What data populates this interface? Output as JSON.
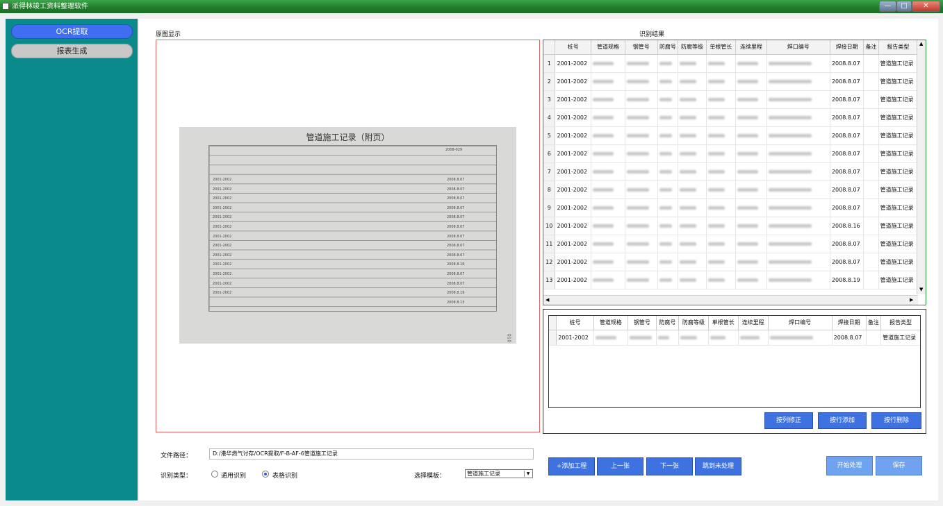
{
  "window": {
    "title": "派得林竣工资料整理软件",
    "min": "—",
    "max": "□",
    "close": "✕"
  },
  "sidebar": {
    "items": [
      {
        "label": "OCR提取"
      },
      {
        "label": "报表生成"
      }
    ]
  },
  "original": {
    "label": "原图显示",
    "doc_title": "管道施工记录（附页）",
    "doc_header": "2008-029",
    "doc_rows": [
      "2001-2002",
      "2001-2002",
      "2001-2002",
      "2001-2002",
      "2001-2002",
      "2001-2002",
      "2001-2002",
      "2001-2002",
      "2001-2002",
      "2001-2002",
      "2001-2002",
      "2001-2002",
      "2001-2002"
    ],
    "doc_dates": [
      "2008.8.07",
      "2008.8.07",
      "2008.8.07",
      "2008.8.07",
      "2008.8.07",
      "2008.8.07",
      "2008.8.07",
      "2008.8.07",
      "2008.8.07",
      "2008.8.16",
      "2008.8.07",
      "2008.8.07",
      "2008.8.19",
      "2008.8.13"
    ],
    "doc_number": "010"
  },
  "result": {
    "label": "识别结果",
    "columns": [
      "桩号",
      "管道规格",
      "钢管号",
      "防腐号",
      "防腐等级",
      "单根管长",
      "连续里程",
      "焊口编号",
      "焊接日期",
      "备注",
      "报告类型"
    ],
    "rows": [
      {
        "num": "1",
        "pile": "2001-2002",
        "date": "2008.8.07",
        "type": "管道施工记录"
      },
      {
        "num": "2",
        "pile": "2001-2002",
        "date": "2008.8.07",
        "type": "管道施工记录"
      },
      {
        "num": "3",
        "pile": "2001-2002",
        "date": "2008.8.07",
        "type": "管道施工记录"
      },
      {
        "num": "4",
        "pile": "2001-2002",
        "date": "2008.8.07",
        "type": "管道施工记录"
      },
      {
        "num": "5",
        "pile": "2001-2002",
        "date": "2008.8.07",
        "type": "管道施工记录"
      },
      {
        "num": "6",
        "pile": "2001-2002",
        "date": "2008.8.07",
        "type": "管道施工记录"
      },
      {
        "num": "7",
        "pile": "2001-2002",
        "date": "2008.8.07",
        "type": "管道施工记录"
      },
      {
        "num": "8",
        "pile": "2001-2002",
        "date": "2008.8.07",
        "type": "管道施工记录"
      },
      {
        "num": "9",
        "pile": "2001-2002",
        "date": "2008.8.07",
        "type": "管道施工记录"
      },
      {
        "num": "10",
        "pile": "2001-2002",
        "date": "2008.8.16",
        "type": "管道施工记录"
      },
      {
        "num": "11",
        "pile": "2001-2002",
        "date": "2008.8.07",
        "type": "管道施工记录"
      },
      {
        "num": "12",
        "pile": "2001-2002",
        "date": "2008.8.07",
        "type": "管道施工记录"
      },
      {
        "num": "13",
        "pile": "2001-2002",
        "date": "2008.8.19",
        "type": "管道施工记录"
      }
    ]
  },
  "detail": {
    "columns": [
      "桩号",
      "管道规格",
      "钢管号",
      "防腐号",
      "防腐等级",
      "单根管长",
      "连续里程",
      "焊口编号",
      "焊接日期",
      "备注",
      "报告类型"
    ],
    "row": {
      "pile": "2001-2002",
      "date": "2008.8.07",
      "type": "管道施工记录"
    },
    "buttons": {
      "col_fix": "按列修正",
      "row_add": "按行添加",
      "row_del": "按行删除"
    }
  },
  "bottom": {
    "path_label": "文件路径：",
    "path_value": "D:/港华燃气讨存/OCR提取/F-B-AF-6管道施工记录",
    "type_label": "识别类型：",
    "radio_general": "通用识别",
    "radio_table": "表格识别",
    "template_label": "选择模板：",
    "template_value": "管道施工记录",
    "buttons": {
      "add_project": "+添加工程",
      "prev": "上一张",
      "next": "下一张",
      "jump": "跳到未处理",
      "start": "开始处理",
      "save": "保存"
    }
  }
}
